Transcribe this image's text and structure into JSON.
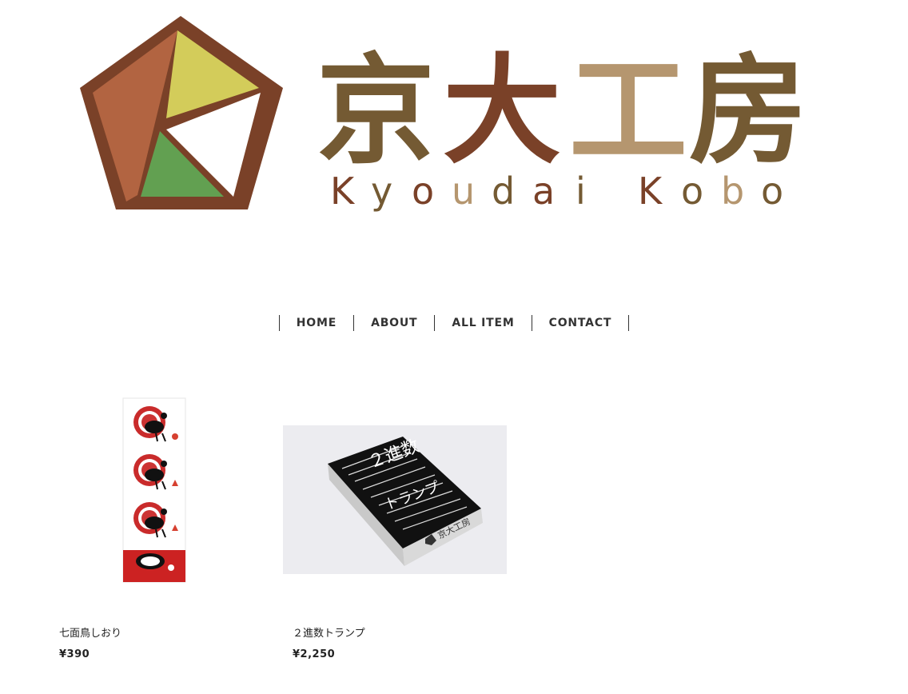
{
  "header": {
    "logo_title": "京大工房",
    "logo_title_chars": [
      "京",
      "大",
      "工",
      "房"
    ],
    "logo_subtitle": "Kyoudai Kobo",
    "logo_subtitle_chars": [
      "K",
      "y",
      "o",
      "u",
      "d",
      "a",
      "i",
      "K",
      "o",
      "b",
      "o"
    ]
  },
  "colors": {
    "brown_dark": "#7a4128",
    "brown_olive": "#745a33",
    "brown_light": "#b5966f",
    "brown_orange": "#b26441",
    "yellow_green": "#d3cc5a",
    "green": "#62a051"
  },
  "nav": {
    "items": [
      {
        "label": "HOME"
      },
      {
        "label": "ABOUT"
      },
      {
        "label": "ALL ITEM"
      },
      {
        "label": "CONTACT"
      }
    ]
  },
  "products": [
    {
      "name": "七面鳥しおり",
      "price": "¥390",
      "image": "turkey-bookmark"
    },
    {
      "name": "２進数トランプ",
      "price": "¥2,250",
      "image": "binary-playing-cards-box"
    }
  ],
  "product_images": {
    "card_box_labels": [
      "京大工房",
      "２進数",
      "トランプ"
    ]
  }
}
